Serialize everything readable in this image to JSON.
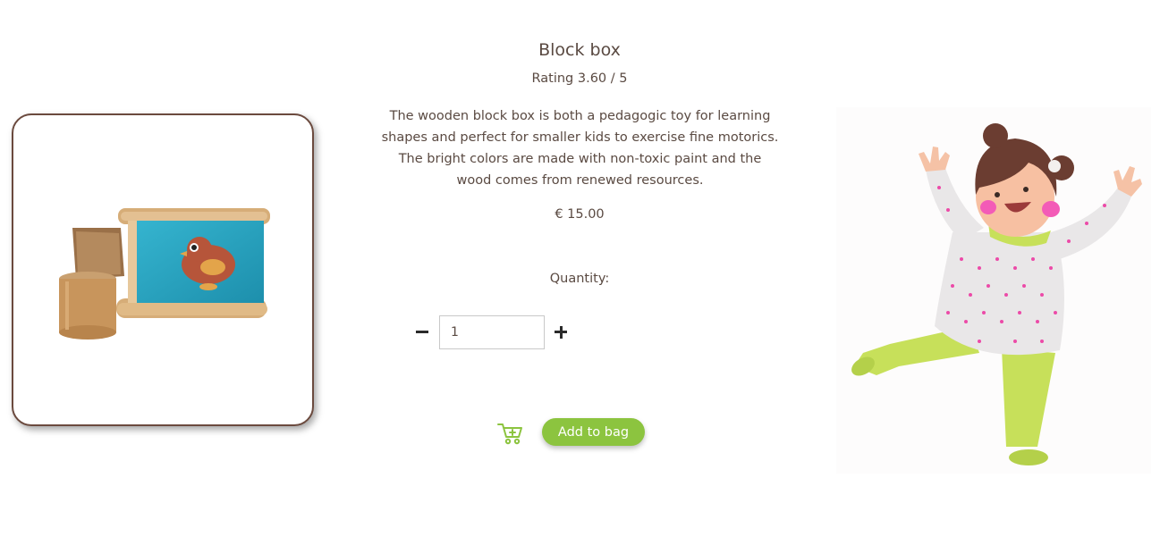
{
  "product": {
    "title": "Block box",
    "rating_label": "Rating",
    "rating_value": "3.60",
    "rating_max": "5",
    "description": "The wooden block box is both a pedagogic toy for learning shapes and perfect for smaller kids to exercise fine motorics. The bright colors are made with non-toxic paint and the wood comes from renewed resources.",
    "price": "€ 15.00",
    "image_icon": "product-photo-wooden-block-box"
  },
  "quantity": {
    "label": "Quantity:",
    "value": "1",
    "minus_icon": "minus-icon",
    "plus_icon": "plus-icon"
  },
  "cart": {
    "icon": "cart-add-icon",
    "add_label": "Add to bag"
  },
  "illustration": {
    "icon": "happy-child-illustration"
  },
  "colors": {
    "text": "#5a4a42",
    "accent_green": "#8cc43f",
    "card_border": "#6b4a3e"
  }
}
